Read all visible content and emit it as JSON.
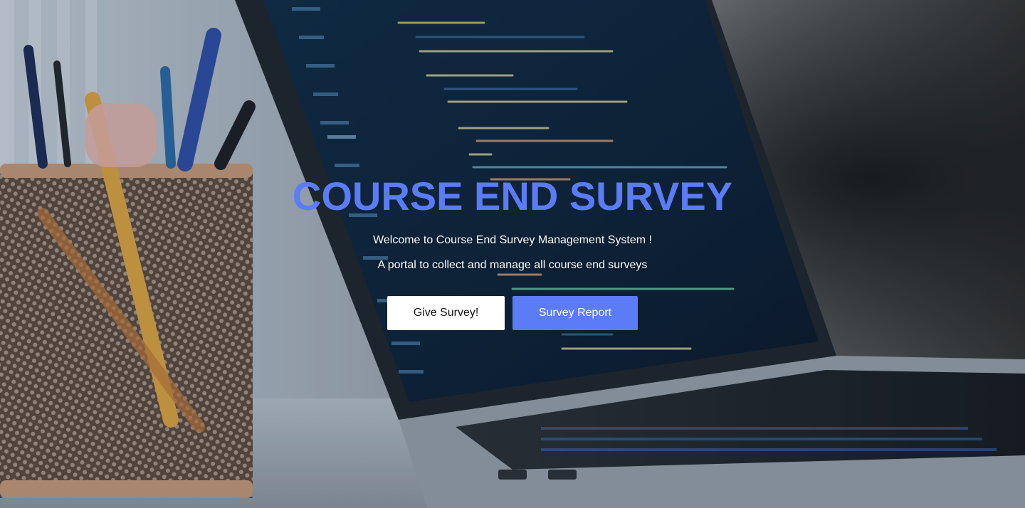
{
  "colors": {
    "accent": "#5b7cf6",
    "overlay": "#1b2a3d"
  },
  "hero": {
    "title": "COURSE END SURVEY",
    "welcome": "Welcome to Course End Survey Management System !",
    "tagline": "A portal to collect and manage all course end surveys"
  },
  "actions": {
    "give_survey_label": "Give Survey!",
    "survey_report_label": "Survey Report"
  },
  "background": {
    "description_icon": "laptop-desk-photo"
  }
}
